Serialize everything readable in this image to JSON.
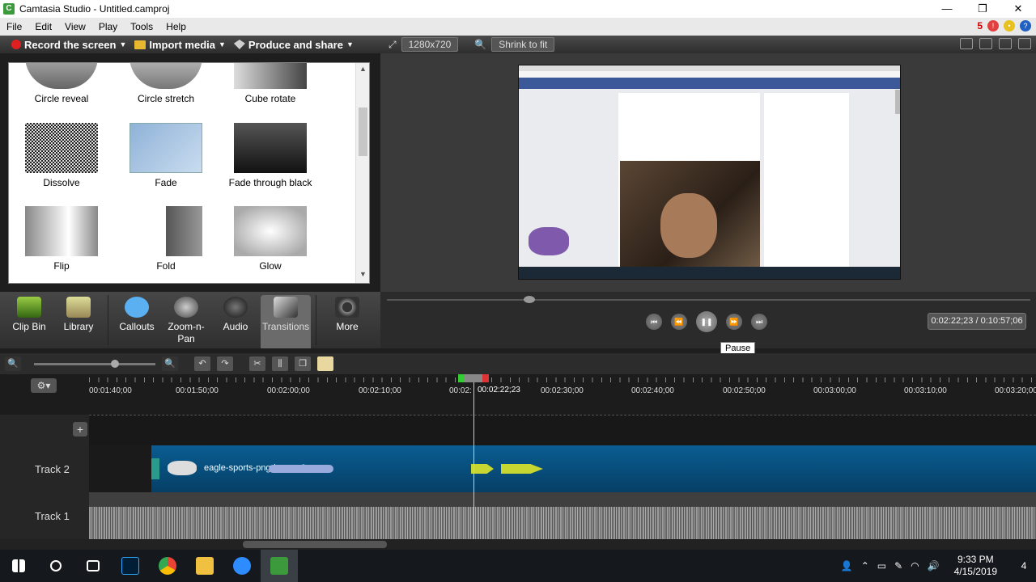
{
  "window": {
    "title": "Camtasia Studio - Untitled.camproj",
    "min": "—",
    "max": "❐",
    "close": "✕"
  },
  "menu": {
    "items": [
      "File",
      "Edit",
      "View",
      "Play",
      "Tools",
      "Help"
    ],
    "notification_count": "5"
  },
  "toolbar": {
    "record": "Record the screen",
    "import": "Import media",
    "produce": "Produce and share"
  },
  "transitions": [
    {
      "label": "Circle reveal"
    },
    {
      "label": "Circle stretch"
    },
    {
      "label": "Cube rotate"
    },
    {
      "label": "Dissolve"
    },
    {
      "label": "Fade"
    },
    {
      "label": "Fade through black"
    },
    {
      "label": "Flip"
    },
    {
      "label": "Fold"
    },
    {
      "label": "Glow"
    }
  ],
  "preview": {
    "resolution": "1280x720",
    "zoom": "Shrink to fit",
    "timecode": "0:02:22;23 / 0:10:57;06",
    "tooltip": "Pause"
  },
  "tabs": [
    {
      "label": "Clip Bin"
    },
    {
      "label": "Library"
    },
    {
      "label": "Callouts"
    },
    {
      "label": "Zoom-n-\nPan"
    },
    {
      "label": "Audio"
    },
    {
      "label": "Transitions"
    },
    {
      "label": "More"
    }
  ],
  "ruler": {
    "labels": [
      "00:01:40;00",
      "00:01:50;00",
      "00:02:00;00",
      "00:02:10;00",
      "00:02:",
      "00:02:30;00",
      "00:02:40;00",
      "00:02:50;00",
      "00:03:00;00",
      "00:03:10;00",
      "00:03:20;00"
    ],
    "current": "00:02:22;23"
  },
  "tracks": {
    "track2": "Track 2",
    "track1": "Track 1",
    "clip_label": "eagle-sports-png-logos--0.png"
  },
  "taskbar": {
    "time": "9:33 PM",
    "date": "4/15/2019",
    "notifications": "4"
  }
}
